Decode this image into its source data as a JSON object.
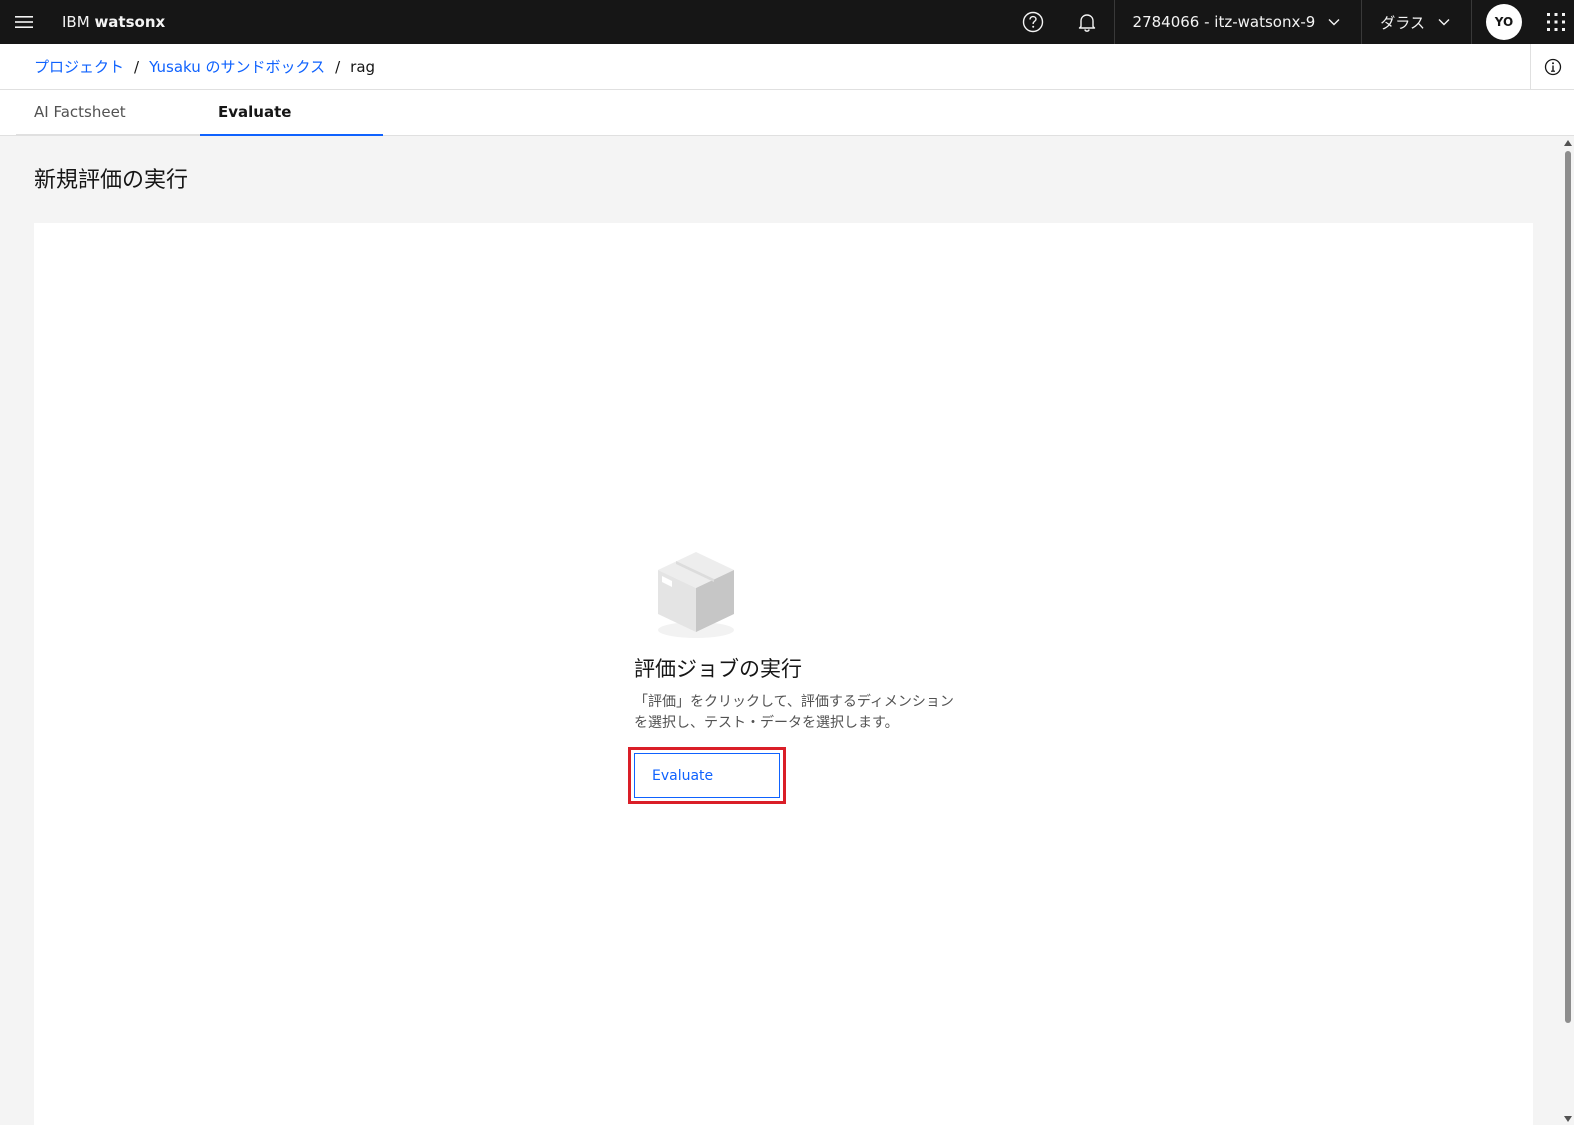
{
  "header": {
    "brand_prefix": "IBM ",
    "brand_name": "watsonx",
    "account_selector": "2784066 - itz-watsonx-9",
    "region_selector": "ダラス",
    "avatar_initials": "YO",
    "icons": [
      "hamburger-menu-icon",
      "help-icon",
      "notification-bell-icon",
      "chevron-down-icon",
      "app-switcher-icon"
    ]
  },
  "breadcrumb": {
    "items": [
      "プロジェクト",
      "Yusaku のサンドボックス",
      "rag"
    ],
    "separator": "/"
  },
  "tabs": [
    {
      "label": "AI Factsheet",
      "selected": false
    },
    {
      "label": "Evaluate",
      "selected": true
    }
  ],
  "main": {
    "page_title": "新規評価の実行",
    "empty_state": {
      "title": "評価ジョブの実行",
      "description": "「評価」をクリックして、評価するディメンションを選択し、テスト・データを選択します。",
      "button_label": "Evaluate",
      "illustration": "box-icon"
    }
  },
  "colors": {
    "header_bg": "#161616",
    "link": "#0f62fe",
    "tab_active_underline": "#0f62fe",
    "highlight_outline": "#da1e28",
    "page_bg": "#f4f4f4",
    "card_bg": "#ffffff"
  }
}
